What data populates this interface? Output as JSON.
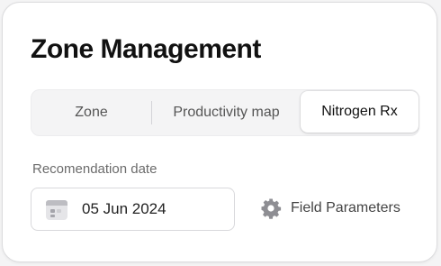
{
  "header": {
    "title": "Zone Management"
  },
  "tabs": {
    "items": [
      {
        "label": "Zone"
      },
      {
        "label": "Productivity map"
      },
      {
        "label": "Nitrogen Rx"
      }
    ],
    "selected": "Nitrogen Rx"
  },
  "recommendation": {
    "label": "Recomendation date",
    "date_value": "05 Jun 2024",
    "icon": "calendar-icon"
  },
  "field_parameters": {
    "label": "Field Parameters",
    "icon": "gear-icon"
  },
  "colors": {
    "text_primary": "#111111",
    "text_secondary": "#6b6b6b",
    "tab_background": "#f4f4f5",
    "icon_gray": "#8e8e93"
  }
}
